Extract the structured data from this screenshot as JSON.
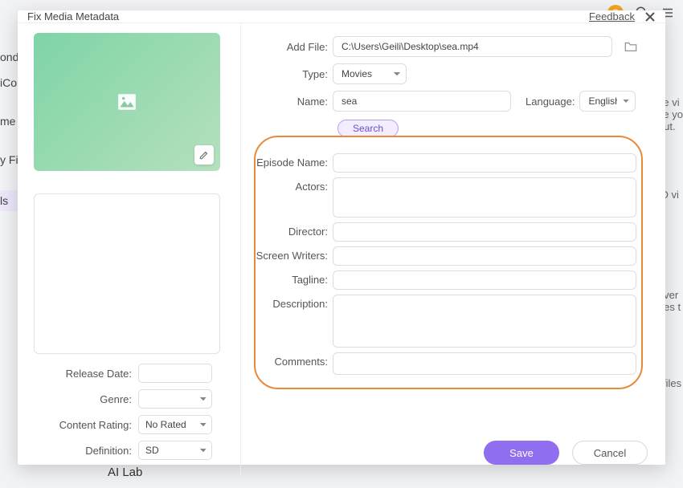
{
  "modal": {
    "title": "Fix Media Metadata",
    "feedback": "Feedback"
  },
  "top": {
    "addFileLbl": "Add File:",
    "addFileVal": "C:\\Users\\Geili\\Desktop\\sea.mp4",
    "typeLbl": "Type:",
    "typeVal": "Movies",
    "nameLbl": "Name:",
    "nameVal": "sea",
    "langLbl": "Language:",
    "langVal": "English",
    "searchBtn": "Search"
  },
  "left": {
    "releaseLbl": "Release Date:",
    "releaseVal": "",
    "genreLbl": "Genre:",
    "genreVal": "",
    "ratingLbl": "Content Rating:",
    "ratingVal": "No Rated",
    "defLbl": "Definition:",
    "defVal": "SD"
  },
  "meta": {
    "episodeLbl": "Episode Name:",
    "actorsLbl": "Actors:",
    "directorLbl": "Director:",
    "writersLbl": "Screen Writers:",
    "taglineLbl": "Tagline:",
    "descLbl": "Description:",
    "commentsLbl": "Comments:"
  },
  "buttons": {
    "save": "Save",
    "cancel": "Cancel"
  },
  "bg": {
    "left1": "onde",
    "left2": "iCor",
    "left3": "me",
    "left4": "y Fil",
    "left5": "ls",
    "r1": "se vi",
    "r2": "ke yo",
    "r3": "out.",
    "r4": "ID vi",
    "r5": "nver",
    "r6": "ges t",
    "r7": "' files",
    "bottom": "AI Lab",
    "avatar": "G"
  }
}
